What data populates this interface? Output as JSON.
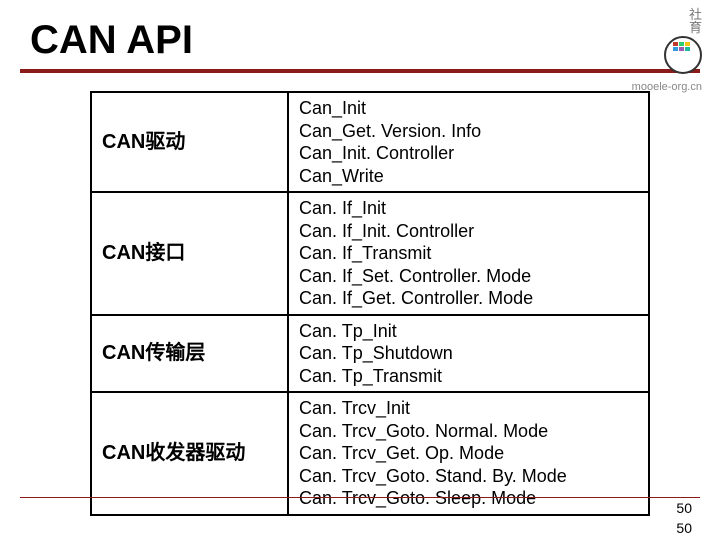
{
  "header": {
    "title": "CAN API",
    "logo_cn_line1": "社",
    "logo_cn_line2": "育",
    "logo_url": "mooele-org.cn"
  },
  "rows": [
    {
      "label": "CAN驱动",
      "apis": [
        "Can_Init",
        "Can_Get. Version. Info",
        "Can_Init. Controller",
        "Can_Write"
      ]
    },
    {
      "label": "CAN接口",
      "apis": [
        "Can. If_Init",
        "Can. If_Init. Controller",
        "Can. If_Transmit",
        "Can. If_Set. Controller. Mode",
        "Can. If_Get. Controller. Mode"
      ]
    },
    {
      "label": "CAN传输层",
      "apis": [
        "Can. Tp_Init",
        "Can. Tp_Shutdown",
        "Can. Tp_Transmit"
      ]
    },
    {
      "label": "CAN收发器驱动",
      "apis": [
        "Can. Trcv_Init",
        "Can. Trcv_Goto. Normal. Mode",
        "Can. Trcv_Get. Op. Mode",
        "Can. Trcv_Goto. Stand. By. Mode",
        "Can. Trcv_Goto. Sleep. Mode"
      ]
    }
  ],
  "page": {
    "inside": "50",
    "outside": "50"
  }
}
